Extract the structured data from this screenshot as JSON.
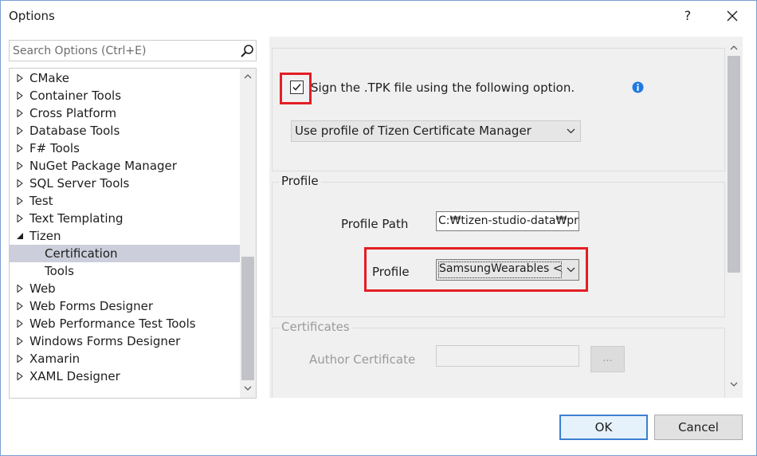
{
  "window": {
    "title": "Options",
    "help_label": "?"
  },
  "search": {
    "placeholder": "Search Options (Ctrl+E)"
  },
  "tree": {
    "items": [
      {
        "label": "CMake",
        "expanded": false
      },
      {
        "label": "Container Tools",
        "expanded": false
      },
      {
        "label": "Cross Platform",
        "expanded": false
      },
      {
        "label": "Database Tools",
        "expanded": false
      },
      {
        "label": "F# Tools",
        "expanded": false
      },
      {
        "label": "NuGet Package Manager",
        "expanded": false
      },
      {
        "label": "SQL Server Tools",
        "expanded": false
      },
      {
        "label": "Test",
        "expanded": false
      },
      {
        "label": "Text Templating",
        "expanded": false
      },
      {
        "label": "Tizen",
        "expanded": true
      },
      {
        "label": "Certification",
        "child": true,
        "selected": true
      },
      {
        "label": "Tools",
        "child": true
      },
      {
        "label": "Web",
        "expanded": false
      },
      {
        "label": "Web Forms Designer",
        "expanded": false
      },
      {
        "label": "Web Performance Test Tools",
        "expanded": false
      },
      {
        "label": "Windows Forms Designer",
        "expanded": false
      },
      {
        "label": "Xamarin",
        "expanded": false
      },
      {
        "label": "XAML Designer",
        "expanded": false
      }
    ]
  },
  "signing": {
    "checkbox_label": "Sign the .TPK file using the following option.",
    "checked": true,
    "option_value": "Use profile of Tizen Certificate Manager"
  },
  "profile_group": {
    "legend": "Profile",
    "path_label": "Profile Path",
    "path_value": "C:₩tizen-studio-data₩pro",
    "profile_label": "Profile",
    "profile_value": "SamsungWearables </"
  },
  "certificates_group": {
    "legend": "Certificates",
    "author_label": "Author Certificate",
    "author_value": "",
    "browse_label": "..."
  },
  "buttons": {
    "ok": "OK",
    "cancel": "Cancel"
  },
  "colors": {
    "highlight": "#e31e24",
    "selection": "#cccedb",
    "accent": "#3c7fd1",
    "info": "#1e7ae0"
  }
}
